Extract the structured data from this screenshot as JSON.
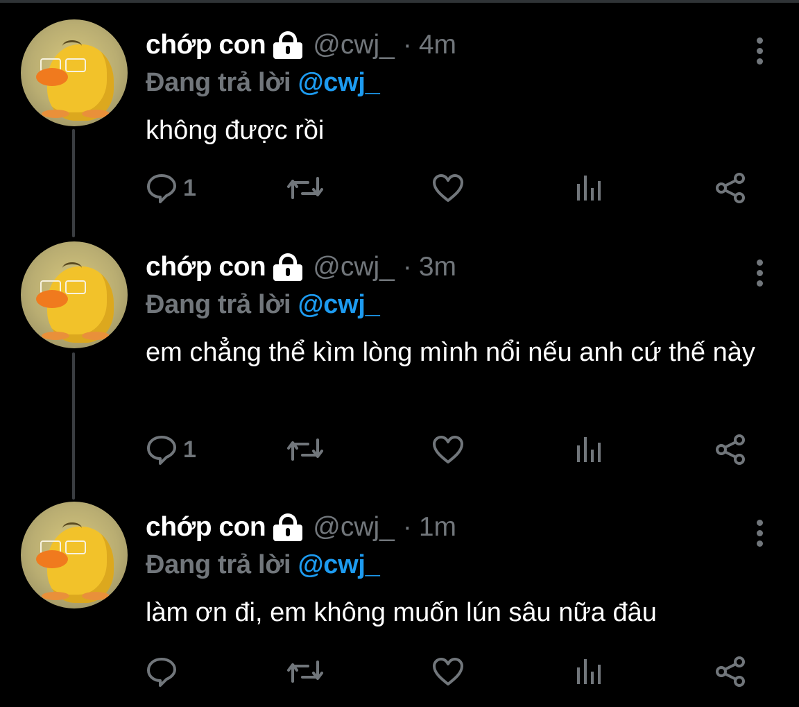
{
  "tweets": [
    {
      "display_name": "chớp con",
      "handle": "@cwj_",
      "separator": "·",
      "time": "4m",
      "replying_prefix": "Đang trả lời",
      "replying_to": "@cwj_",
      "text": "không được rồi",
      "reply_count": "1"
    },
    {
      "display_name": "chớp con",
      "handle": "@cwj_",
      "separator": "·",
      "time": "3m",
      "replying_prefix": "Đang trả lời",
      "replying_to": "@cwj_",
      "text": "em chẳng thể kìm lòng mình nổi nếu anh cứ thế này",
      "reply_count": "1"
    },
    {
      "display_name": "chớp con",
      "handle": "@cwj_",
      "separator": "·",
      "time": "1m",
      "replying_prefix": "Đang trả lời",
      "replying_to": "@cwj_",
      "text": "làm ơn đi, em không muốn lún sâu nữa đâu",
      "reply_count": ""
    }
  ],
  "icons": {
    "lock": "lock-icon",
    "more": "more-vertical-icon",
    "reply": "reply-bubble-icon",
    "retweet": "retweet-icon",
    "like": "heart-icon",
    "analytics": "analytics-bars-icon",
    "share": "share-icon"
  },
  "colors": {
    "background": "#000000",
    "secondary_text": "#71767b",
    "mention": "#1d9bf0",
    "thread_line": "#3a3d41"
  }
}
